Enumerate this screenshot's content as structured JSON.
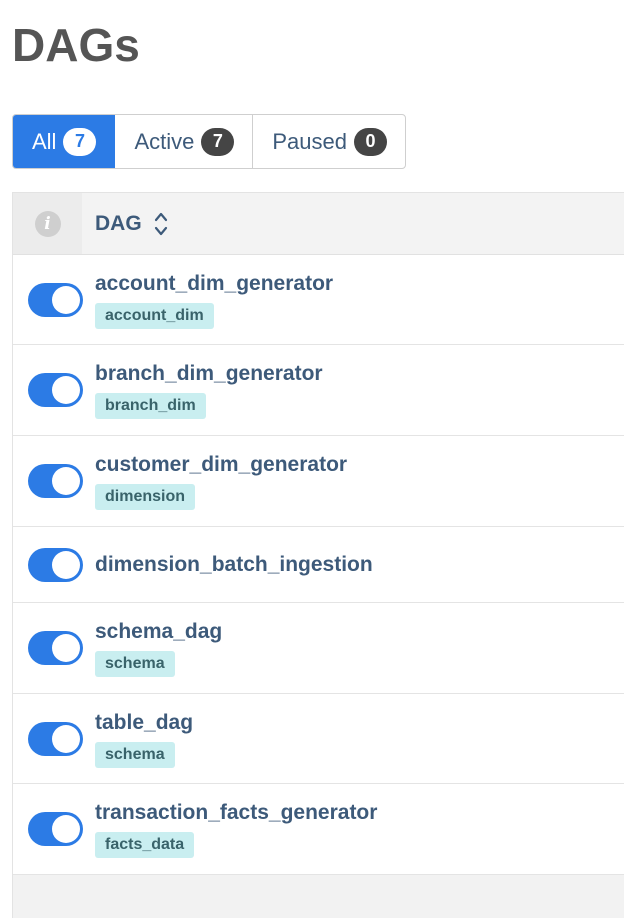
{
  "page": {
    "title": "DAGs"
  },
  "filters": [
    {
      "label": "All",
      "count": "7",
      "active": true
    },
    {
      "label": "Active",
      "count": "7",
      "active": false
    },
    {
      "label": "Paused",
      "count": "0",
      "active": false
    }
  ],
  "table": {
    "info_icon": "info-icon",
    "dag_header": "DAG",
    "sort_icon": "sort-icon"
  },
  "dags": [
    {
      "name": "account_dim_generator",
      "tag": "account_dim",
      "enabled": true
    },
    {
      "name": "branch_dim_generator",
      "tag": "branch_dim",
      "enabled": true
    },
    {
      "name": "customer_dim_generator",
      "tag": "dimension",
      "enabled": true
    },
    {
      "name": "dimension_batch_ingestion",
      "tag": "",
      "enabled": true
    },
    {
      "name": "schema_dag",
      "tag": "schema",
      "enabled": true
    },
    {
      "name": "table_dag",
      "tag": "schema",
      "enabled": true
    },
    {
      "name": "transaction_facts_generator",
      "tag": "facts_data",
      "enabled": true
    }
  ],
  "colors": {
    "accent": "#2c7be5",
    "link": "#3d5a7a",
    "tag_bg": "#c9eef0"
  }
}
